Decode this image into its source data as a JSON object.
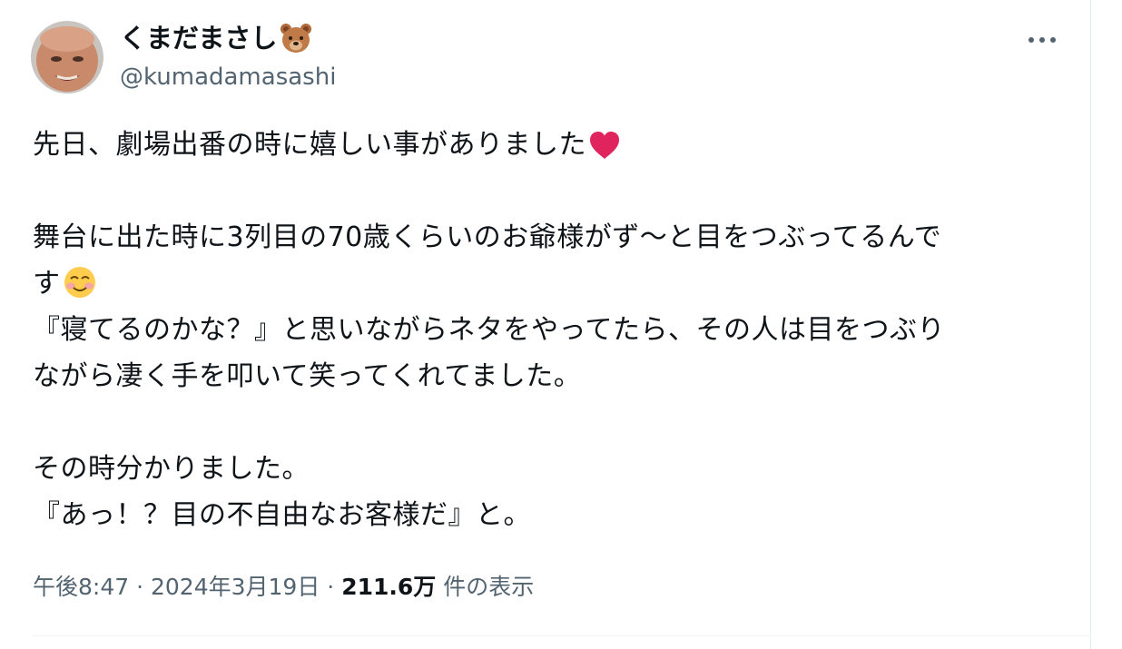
{
  "author": {
    "display_name": "くまだまさし",
    "name_emoji": "bear-face-icon",
    "handle": "@kumadamasashi"
  },
  "more_menu_icon": "more-horizontal-icon",
  "tweet": {
    "lines": [
      "先日、劇場出番の時に嬉しい事がありました",
      "",
      "舞台に出た時に3列目の70歳くらいのお爺様がず～と目をつぶってるんです",
      "",
      "『寝てるのかな？』と思いながらネタをやってたら、その人は目をつぶり",
      "ながら凄く手を叩いて笑ってくれてました。",
      "",
      "その時分かりました。",
      "『あっ！？目の不自由なお客様だ』と。"
    ],
    "line_1": "先日、劇場出番の時に嬉しい事がありました",
    "line_3": "舞台に出た時に3列目の70歳くらいのお爺様がず～と目をつぶってるんで",
    "line_4": "す",
    "line_5": "『寝てるのかな？』と思いながらネタをやってたら、その人は目をつぶり",
    "line_6": "ながら凄く手を叩いて笑ってくれてました。",
    "line_8": "その時分かりました。",
    "line_9": "『あっ！？目の不自由なお客様だ』と。",
    "emoji_1": "red-heart-icon",
    "emoji_2": "smiling-face-icon"
  },
  "meta": {
    "time": "午後8:47",
    "separator": "·",
    "date": "2024年3月19日",
    "views_count": "211.6万",
    "views_label": "件の表示"
  },
  "colors": {
    "text": "#0f1419",
    "secondary": "#536471",
    "heart": "#e0245e",
    "divider": "#eff3f4"
  }
}
